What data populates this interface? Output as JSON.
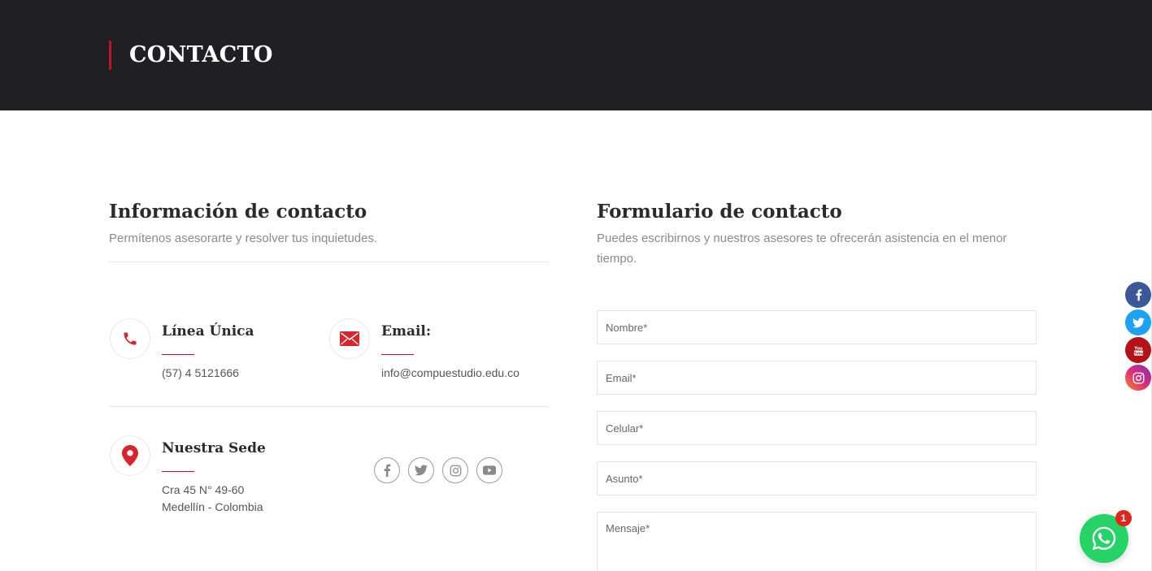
{
  "hero": {
    "title": "CONTACTO"
  },
  "info": {
    "title": "Información de contacto",
    "subtitle": "Permítenos asesorarte y resolver tus inquietudes.",
    "phone": {
      "title": "Línea Única",
      "value": "(57) 4 5121666",
      "icon": "phone-icon"
    },
    "email": {
      "title": "Email:",
      "value": "info@compuestudio.edu.co",
      "icon": "mail-icon"
    },
    "sede": {
      "title": "Nuestra Sede",
      "line1": "Cra 45 N° 49-60",
      "line2": "Medellín - Colombia",
      "icon": "map-pin-icon"
    },
    "socials": [
      "facebook-icon",
      "twitter-icon",
      "instagram-icon",
      "youtube-icon"
    ]
  },
  "form": {
    "title": "Formulario de contacto",
    "subtitle": "Puedes escribirnos y nuestros asesores te ofrecerán asistencia en el menor tiempo.",
    "nombre_placeholder": "Nombre*",
    "email_placeholder": "Email*",
    "celular_placeholder": "Celular*",
    "asunto_placeholder": "Asunto*",
    "mensaje_placeholder": "Mensaje*"
  },
  "floating_social": [
    {
      "icon": "facebook-icon",
      "color": "#3b5998"
    },
    {
      "icon": "twitter-icon",
      "color": "#1da1f2"
    },
    {
      "icon": "youtube-icon",
      "color": "#c4302b"
    },
    {
      "icon": "instagram-icon",
      "color": "#e1306c"
    }
  ],
  "whatsapp": {
    "badge": "1",
    "icon": "whatsapp-icon",
    "color": "#25d366"
  },
  "colors": {
    "accent": "#c8102e",
    "hero_bg": "#1f1f24"
  }
}
